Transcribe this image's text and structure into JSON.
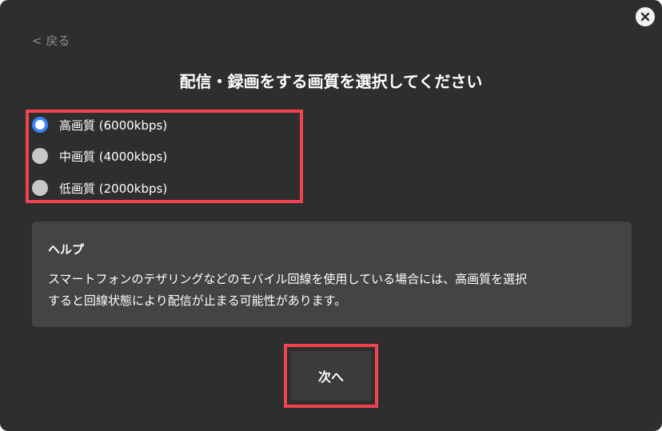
{
  "dialog": {
    "back_label": "< 戻る",
    "title": "配信・録画をする画質を選択してください",
    "close_icon": "close-icon"
  },
  "quality_options": [
    {
      "label": "高画質 (6000kbps)",
      "selected": true
    },
    {
      "label": "中画質 (4000kbps)",
      "selected": false
    },
    {
      "label": "低画質 (2000kbps)",
      "selected": false
    }
  ],
  "help": {
    "title": "ヘルプ",
    "line1": "スマートフォンのテザリングなどのモバイル回線を使用している場合には、高画質を選択",
    "line2": "すると回線状態により配信が止まる可能性があります。"
  },
  "next_button": {
    "label": "次へ"
  },
  "colors": {
    "background": "#2e2e2e",
    "help_background": "#444444",
    "highlight": "#f2434e",
    "radio_accent": "#3b82f6"
  }
}
